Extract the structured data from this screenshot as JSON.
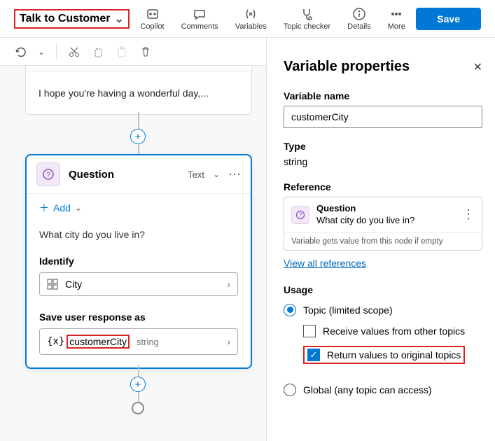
{
  "header": {
    "topic_name": "Talk to Customer",
    "tools": {
      "copilot": "Copilot",
      "comments": "Comments",
      "variables": "Variables",
      "topic_checker": "Topic checker",
      "details": "Details",
      "more": "More"
    },
    "save": "Save"
  },
  "canvas": {
    "message_preview": "I hope you're having a wonderful day,...",
    "question": {
      "title": "Question",
      "type_label": "Text",
      "add_label": "Add",
      "prompt": "What city do you live in?",
      "identify_label": "Identify",
      "identify_value": "City",
      "save_as_label": "Save user response as",
      "var_name": "customerCity",
      "var_type": "string"
    }
  },
  "panel": {
    "title": "Variable properties",
    "var_name_label": "Variable name",
    "var_name_value": "customerCity",
    "type_label": "Type",
    "type_value": "string",
    "reference_label": "Reference",
    "reference_title": "Question",
    "reference_text": "What city do you live in?",
    "reference_note": "Variable gets value from this node if empty",
    "view_all": "View all references",
    "usage_label": "Usage",
    "usage_topic": "Topic (limited scope)",
    "usage_receive": "Receive values from other topics",
    "usage_return": "Return values to original topics",
    "usage_global": "Global (any topic can access)"
  }
}
